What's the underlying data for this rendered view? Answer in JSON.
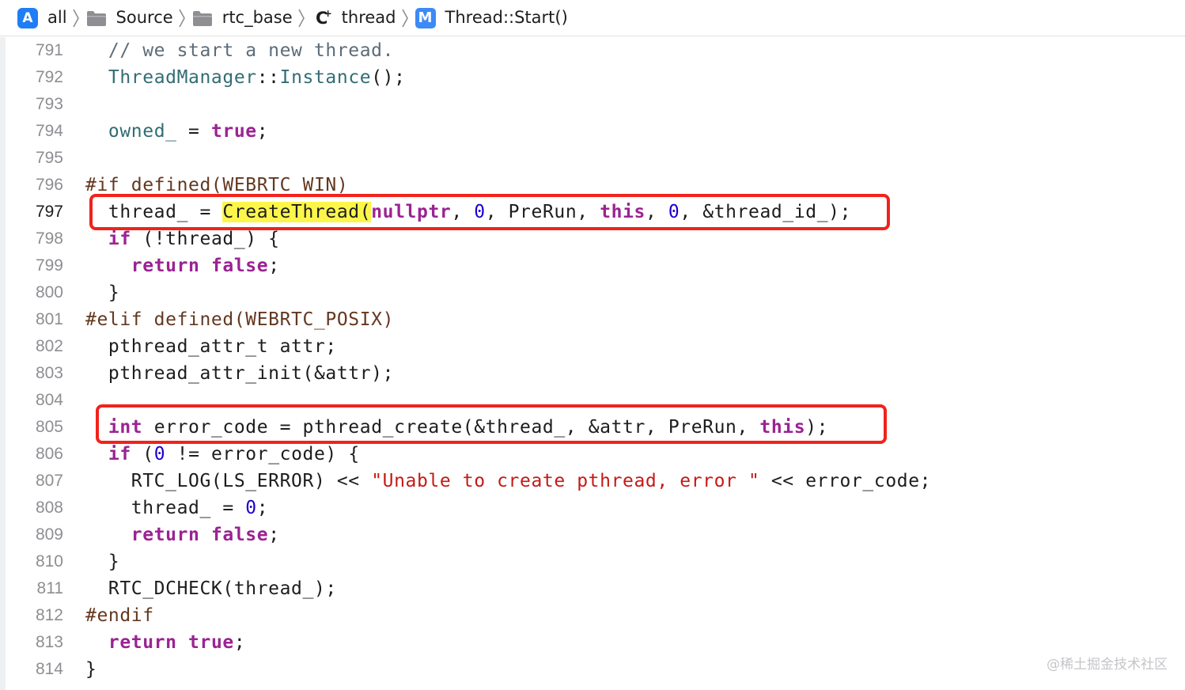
{
  "breadcrumb": [
    {
      "label": "all",
      "icon": "app-icon"
    },
    {
      "label": "Source",
      "icon": "folder-icon"
    },
    {
      "label": "rtc_base",
      "icon": "folder-icon"
    },
    {
      "label": "thread",
      "icon": "cpp-file-icon"
    },
    {
      "label": "Thread::Start()",
      "icon": "method-icon"
    }
  ],
  "icons": {
    "app": "A",
    "cpp": "C",
    "cpp_plus": "+",
    "method": "M"
  },
  "current_line": 797,
  "code": [
    {
      "n": "791",
      "tokens": [
        {
          "t": "  // we start a new thread.",
          "c": "comment"
        }
      ]
    },
    {
      "n": "792",
      "tokens": [
        {
          "t": "  ",
          "c": "plain"
        },
        {
          "t": "ThreadManager",
          "c": "type"
        },
        {
          "t": "::",
          "c": "plain"
        },
        {
          "t": "Instance",
          "c": "type"
        },
        {
          "t": "();",
          "c": "plain"
        }
      ]
    },
    {
      "n": "793",
      "tokens": []
    },
    {
      "n": "794",
      "tokens": [
        {
          "t": "  ",
          "c": "plain"
        },
        {
          "t": "owned_",
          "c": "prop"
        },
        {
          "t": " = ",
          "c": "plain"
        },
        {
          "t": "true",
          "c": "keyword"
        },
        {
          "t": ";",
          "c": "plain"
        }
      ]
    },
    {
      "n": "795",
      "tokens": []
    },
    {
      "n": "796",
      "tokens": [
        {
          "t": "#if defined(WEBRTC_WIN)",
          "c": "pre"
        }
      ]
    },
    {
      "n": "797",
      "tokens": [
        {
          "t": "  thread_ = ",
          "c": "plain"
        },
        {
          "t": "CreateThread(",
          "c": "hl"
        },
        {
          "t": "nullptr",
          "c": "keyword"
        },
        {
          "t": ", ",
          "c": "plain"
        },
        {
          "t": "0",
          "c": "number"
        },
        {
          "t": ", PreRun, ",
          "c": "plain"
        },
        {
          "t": "this",
          "c": "keyword"
        },
        {
          "t": ", ",
          "c": "plain"
        },
        {
          "t": "0",
          "c": "number"
        },
        {
          "t": ", &thread_id_);",
          "c": "plain"
        }
      ]
    },
    {
      "n": "798",
      "tokens": [
        {
          "t": "  ",
          "c": "plain"
        },
        {
          "t": "if",
          "c": "keyword"
        },
        {
          "t": " (!thread_) {",
          "c": "plain"
        }
      ]
    },
    {
      "n": "799",
      "tokens": [
        {
          "t": "    ",
          "c": "plain"
        },
        {
          "t": "return",
          "c": "keyword"
        },
        {
          "t": " ",
          "c": "plain"
        },
        {
          "t": "false",
          "c": "keyword"
        },
        {
          "t": ";",
          "c": "plain"
        }
      ]
    },
    {
      "n": "800",
      "tokens": [
        {
          "t": "  }",
          "c": "plain"
        }
      ]
    },
    {
      "n": "801",
      "tokens": [
        {
          "t": "#elif defined(WEBRTC_POSIX)",
          "c": "pre"
        }
      ]
    },
    {
      "n": "802",
      "tokens": [
        {
          "t": "  pthread_attr_t attr;",
          "c": "plain"
        }
      ]
    },
    {
      "n": "803",
      "tokens": [
        {
          "t": "  pthread_attr_init(&attr);",
          "c": "plain"
        }
      ]
    },
    {
      "n": "804",
      "tokens": []
    },
    {
      "n": "805",
      "tokens": [
        {
          "t": "  ",
          "c": "plain"
        },
        {
          "t": "int",
          "c": "keyword"
        },
        {
          "t": " error_code = pthread_create(&thread_, &attr, PreRun, ",
          "c": "plain"
        },
        {
          "t": "this",
          "c": "keyword"
        },
        {
          "t": ");",
          "c": "plain"
        }
      ]
    },
    {
      "n": "806",
      "tokens": [
        {
          "t": "  ",
          "c": "plain"
        },
        {
          "t": "if",
          "c": "keyword"
        },
        {
          "t": " (",
          "c": "plain"
        },
        {
          "t": "0",
          "c": "number"
        },
        {
          "t": " != error_code) {",
          "c": "plain"
        }
      ]
    },
    {
      "n": "807",
      "tokens": [
        {
          "t": "    RTC_LOG(LS_ERROR) << ",
          "c": "plain"
        },
        {
          "t": "\"Unable to create pthread, error \"",
          "c": "string"
        },
        {
          "t": " << error_code;",
          "c": "plain"
        }
      ]
    },
    {
      "n": "808",
      "tokens": [
        {
          "t": "    thread_ = ",
          "c": "plain"
        },
        {
          "t": "0",
          "c": "number"
        },
        {
          "t": ";",
          "c": "plain"
        }
      ]
    },
    {
      "n": "809",
      "tokens": [
        {
          "t": "    ",
          "c": "plain"
        },
        {
          "t": "return",
          "c": "keyword"
        },
        {
          "t": " ",
          "c": "plain"
        },
        {
          "t": "false",
          "c": "keyword"
        },
        {
          "t": ";",
          "c": "plain"
        }
      ]
    },
    {
      "n": "810",
      "tokens": [
        {
          "t": "  }",
          "c": "plain"
        }
      ]
    },
    {
      "n": "811",
      "tokens": [
        {
          "t": "  RTC_DCHECK(thread_);",
          "c": "plain"
        }
      ]
    },
    {
      "n": "812",
      "tokens": [
        {
          "t": "#endif",
          "c": "pre"
        }
      ]
    },
    {
      "n": "813",
      "tokens": [
        {
          "t": "  ",
          "c": "plain"
        },
        {
          "t": "return",
          "c": "keyword"
        },
        {
          "t": " ",
          "c": "plain"
        },
        {
          "t": "true",
          "c": "keyword"
        },
        {
          "t": ";",
          "c": "plain"
        }
      ]
    },
    {
      "n": "814",
      "tokens": [
        {
          "t": "}",
          "c": "plain"
        }
      ]
    }
  ],
  "watermark": "@稀土掘金技术社区",
  "colors": {
    "annotation": "#f2221c",
    "highlight": "#fdf64a",
    "keyword": "#9b2393",
    "type": "#326d74",
    "string": "#c41a16",
    "number": "#1c00cf",
    "preprocessor": "#643820"
  }
}
